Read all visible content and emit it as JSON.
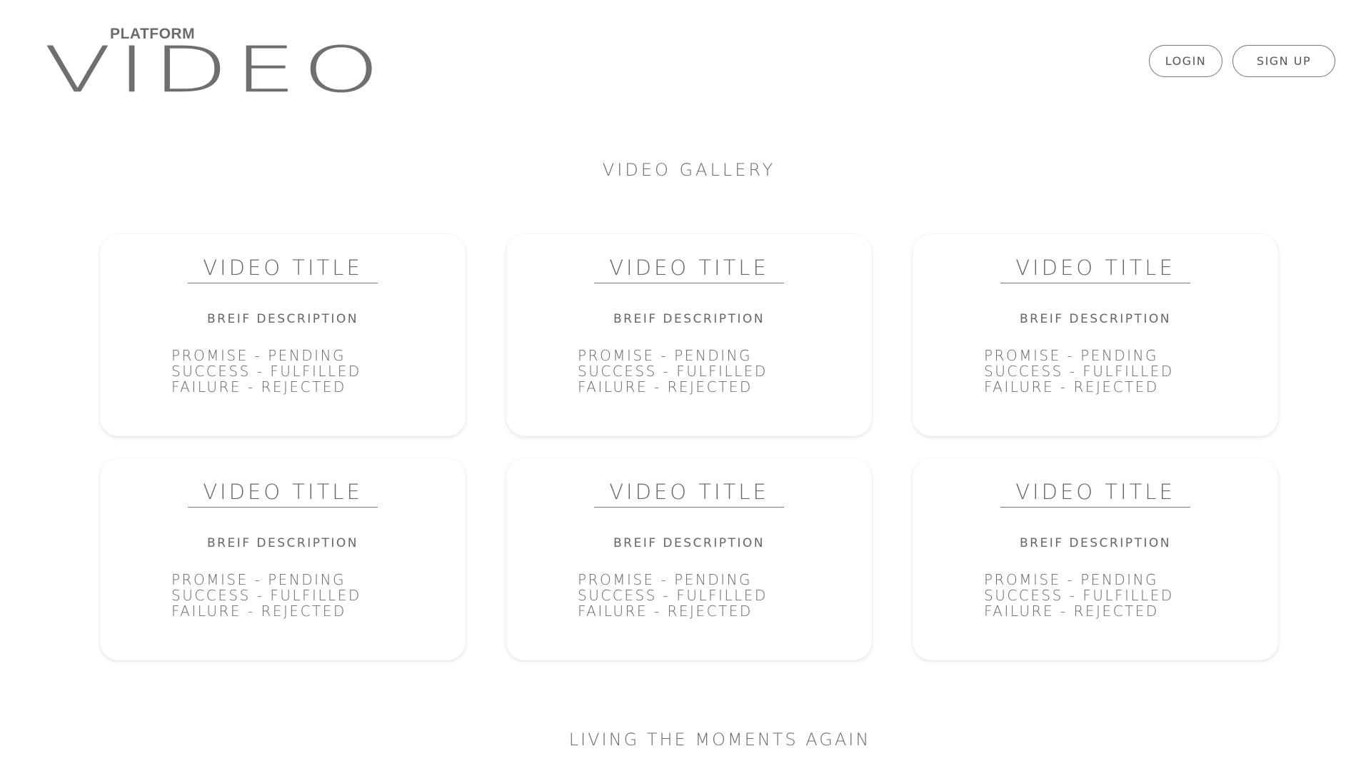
{
  "header": {
    "logo_sub": "PLATFORM",
    "logo_main": "VIDEO",
    "login_label": "LOGIN",
    "signup_label": "SIGN UP"
  },
  "gallery": {
    "title": "VIDEO GALLERY",
    "cards": [
      {
        "title": "VIDEO TITLE",
        "description": "BREIF DESCRIPTION",
        "lines": [
          "PROMISE - PENDING",
          "SUCCESS - FULFILLED",
          "FAILURE - REJECTED"
        ]
      },
      {
        "title": "VIDEO TITLE",
        "description": "BREIF DESCRIPTION",
        "lines": [
          "PROMISE - PENDING",
          "SUCCESS - FULFILLED",
          "FAILURE - REJECTED"
        ]
      },
      {
        "title": "VIDEO TITLE",
        "description": "BREIF DESCRIPTION",
        "lines": [
          "PROMISE - PENDING",
          "SUCCESS - FULFILLED",
          "FAILURE - REJECTED"
        ]
      },
      {
        "title": "VIDEO TITLE",
        "description": "BREIF DESCRIPTION",
        "lines": [
          "PROMISE - PENDING",
          "SUCCESS - FULFILLED",
          "FAILURE - REJECTED"
        ]
      },
      {
        "title": "VIDEO TITLE",
        "description": "BREIF DESCRIPTION",
        "lines": [
          "PROMISE - PENDING",
          "SUCCESS - FULFILLED",
          "FAILURE - REJECTED"
        ]
      },
      {
        "title": "VIDEO TITLE",
        "description": "BREIF DESCRIPTION",
        "lines": [
          "PROMISE - PENDING",
          "SUCCESS - FULFILLED",
          "FAILURE - REJECTED"
        ]
      }
    ]
  },
  "footer": {
    "tagline": "LIVING THE MOMENTS AGAIN"
  }
}
